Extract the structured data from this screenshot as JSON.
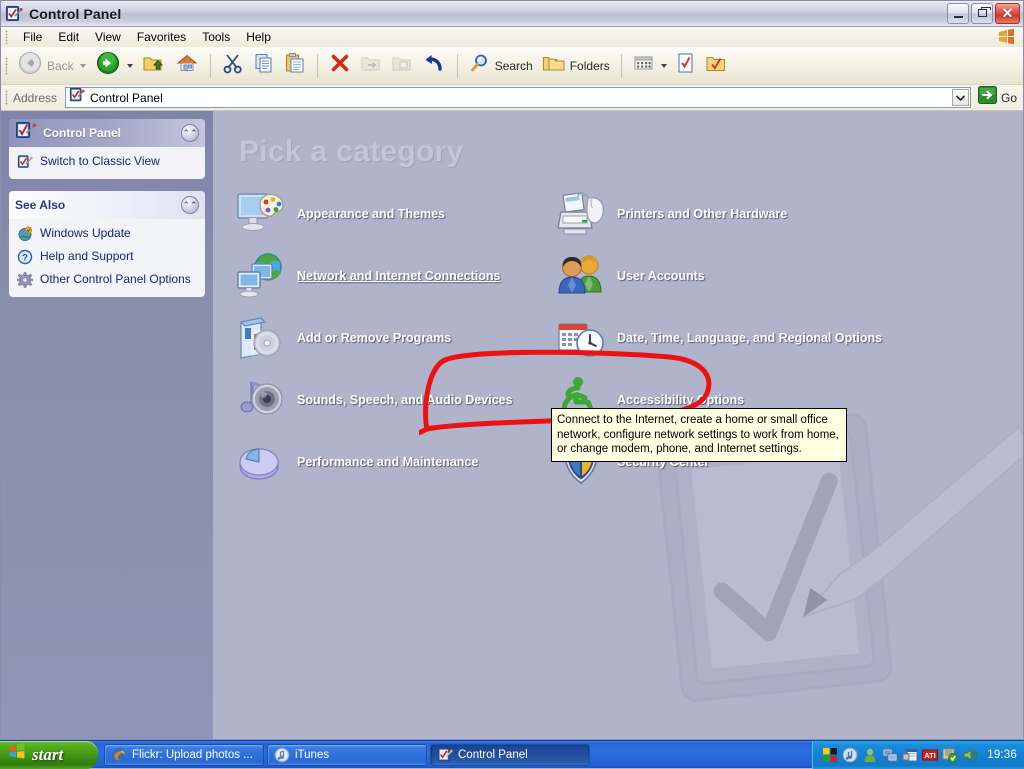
{
  "window": {
    "title": "Control Panel",
    "title_icon": "control-panel-icon",
    "buttons": {
      "minimize": "Minimize",
      "maximize": "Restore",
      "close": "Close"
    }
  },
  "menubar": {
    "items": [
      {
        "label": "File"
      },
      {
        "label": "Edit"
      },
      {
        "label": "View"
      },
      {
        "label": "Favorites"
      },
      {
        "label": "Tools"
      },
      {
        "label": "Help"
      }
    ]
  },
  "toolbar": {
    "back_label": "Back",
    "back_icon": "back-arrow-icon",
    "forward_icon": "forward-arrow-icon",
    "up_icon": "up-folder-icon",
    "home_icon": "home-icon",
    "cut_icon": "scissors-icon",
    "copy_icon": "copy-icon",
    "paste_icon": "paste-icon",
    "delete_icon": "delete-x-icon",
    "move_to_icon": "move-to-folder-icon",
    "copy_to_icon": "copy-to-folder-icon",
    "undo_icon": "undo-icon",
    "search_label": "Search",
    "search_icon": "magnifier-icon",
    "folders_label": "Folders",
    "folders_icon": "folders-icon",
    "views_icon": "views-icon",
    "extra1_icon": "checklist-document-icon",
    "extra2_icon": "checklist-folder-icon"
  },
  "address": {
    "label": "Address",
    "value": "Control Panel",
    "icon": "control-panel-icon",
    "dropdown_icon": "chevron-down-icon",
    "go_label": "Go",
    "go_icon": "go-arrow-icon"
  },
  "sidebar": {
    "panels": [
      {
        "title": "Control Panel",
        "icon": "control-panel-icon",
        "collapse_icon": "chevron-up-icon",
        "links": [
          {
            "label": "Switch to Classic View",
            "icon": "classic-view-icon"
          }
        ]
      },
      {
        "title": "See Also",
        "collapse_icon": "chevron-up-icon",
        "links": [
          {
            "label": "Windows Update",
            "icon": "windows-update-icon"
          },
          {
            "label": "Help and Support",
            "icon": "help-icon"
          },
          {
            "label": "Other Control Panel Options",
            "icon": "gear-icon"
          }
        ]
      }
    ]
  },
  "main": {
    "heading": "Pick a category",
    "categories": [
      {
        "label": "Appearance and Themes",
        "icon": "appearance-themes-icon",
        "col": 0,
        "row": 0,
        "highlighted": false
      },
      {
        "label": "Printers and Other Hardware",
        "icon": "printers-hardware-icon",
        "col": 1,
        "row": 0,
        "highlighted": false
      },
      {
        "label": "Network and Internet Connections",
        "icon": "network-internet-icon",
        "col": 0,
        "row": 1,
        "highlighted": true
      },
      {
        "label": "User Accounts",
        "icon": "user-accounts-icon",
        "col": 1,
        "row": 1,
        "highlighted": false
      },
      {
        "label": "Add or Remove Programs",
        "icon": "add-remove-programs-icon",
        "col": 0,
        "row": 2,
        "highlighted": false
      },
      {
        "label": "Date, Time, Language, and Regional Options",
        "icon": "date-time-regional-icon",
        "col": 1,
        "row": 2,
        "highlighted": false
      },
      {
        "label": "Sounds, Speech, and Audio Devices",
        "icon": "sounds-audio-icon",
        "col": 0,
        "row": 3,
        "highlighted": false
      },
      {
        "label": "Accessibility Options",
        "icon": "accessibility-icon",
        "col": 1,
        "row": 3,
        "highlighted": false
      },
      {
        "label": "Performance and Maintenance",
        "icon": "performance-maintenance-icon",
        "col": 0,
        "row": 4,
        "highlighted": false
      },
      {
        "label": "Security Center",
        "icon": "security-center-icon",
        "col": 1,
        "row": 4,
        "highlighted": false
      }
    ],
    "tooltip": "Connect to the Internet, create a home or small office network, configure network settings to work from home, or change modem, phone, and Internet settings.",
    "watermark_icon": "clipboard-check-pen-watermark"
  },
  "annotation": {
    "shape": "hand-drawn-red-ellipse",
    "color": "#ee1111",
    "targets": "Network and Internet Connections"
  },
  "taskbar": {
    "start_label": "start",
    "start_icon": "windows-flag-icon",
    "buttons": [
      {
        "label": "Flickr: Upload photos ...",
        "icon": "firefox-icon",
        "active": false
      },
      {
        "label": "iTunes",
        "icon": "itunes-icon",
        "active": false
      },
      {
        "label": "Control Panel",
        "icon": "control-panel-icon",
        "active": true
      }
    ],
    "tray": {
      "icons": [
        "color-squares-icon",
        "itunes-tray-icon",
        "user-tray-icon",
        "network-tray-icon",
        "security-tray-icon",
        "ati-tray-icon",
        "update-check-tray-icon",
        "volume-tray-icon"
      ],
      "clock": "19:36"
    }
  },
  "colors": {
    "content_bg": "#b0b4ca",
    "sidebar_bg": "#8a8fb0",
    "annotation_red": "#ee1111",
    "tooltip_bg": "#ffffe1",
    "taskbar_blue": "#2a65d4",
    "start_green": "#3f9213"
  }
}
